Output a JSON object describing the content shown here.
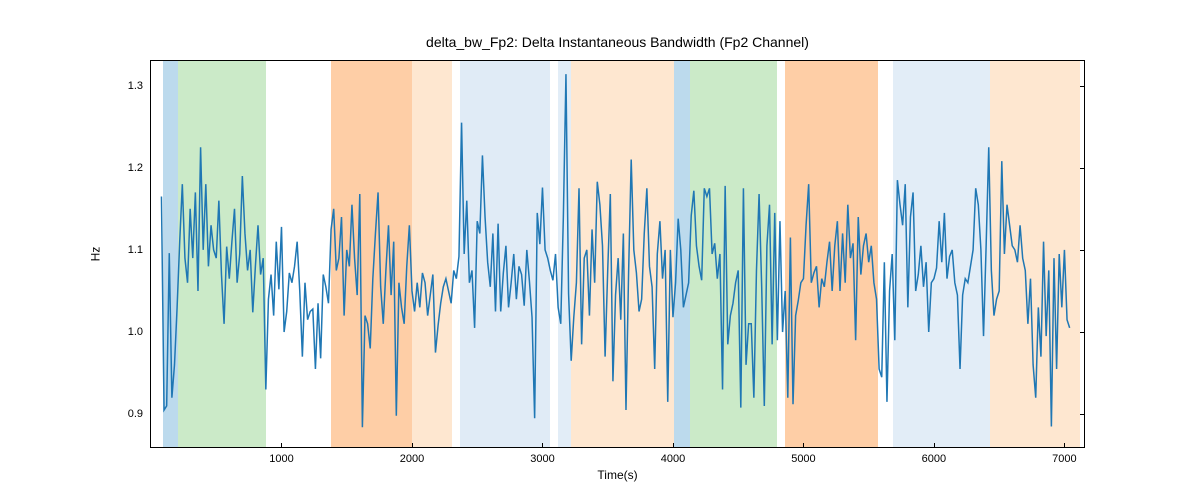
{
  "chart_data": {
    "type": "line",
    "title": "delta_bw_Fp2: Delta Instantaneous Bandwidth (Fp2 Channel)",
    "xlabel": "Time(s)",
    "ylabel": "Hz",
    "xlim": [
      0,
      7150
    ],
    "ylim": [
      0.86,
      1.33
    ],
    "xticks": [
      1000,
      2000,
      3000,
      4000,
      5000,
      6000,
      7000
    ],
    "yticks": [
      0.9,
      1.0,
      1.1,
      1.2,
      1.3
    ],
    "bands": [
      {
        "x0": 90,
        "x1": 210,
        "color": "#6baed6",
        "alpha": 0.45
      },
      {
        "x0": 210,
        "x1": 880,
        "color": "#a1d99b",
        "alpha": 0.55
      },
      {
        "x0": 1380,
        "x1": 2000,
        "color": "#fdae6b",
        "alpha": 0.6
      },
      {
        "x0": 2000,
        "x1": 2310,
        "color": "#fdd0a2",
        "alpha": 0.5
      },
      {
        "x0": 2370,
        "x1": 3060,
        "color": "#c6dbef",
        "alpha": 0.55
      },
      {
        "x0": 3120,
        "x1": 3220,
        "color": "#c6dbef",
        "alpha": 0.5
      },
      {
        "x0": 3220,
        "x1": 4010,
        "color": "#fdd0a2",
        "alpha": 0.5
      },
      {
        "x0": 4010,
        "x1": 4130,
        "color": "#6baed6",
        "alpha": 0.45
      },
      {
        "x0": 4130,
        "x1": 4800,
        "color": "#a1d99b",
        "alpha": 0.55
      },
      {
        "x0": 4860,
        "x1": 5570,
        "color": "#fdae6b",
        "alpha": 0.6
      },
      {
        "x0": 5690,
        "x1": 6430,
        "color": "#c6dbef",
        "alpha": 0.5
      },
      {
        "x0": 6430,
        "x1": 7120,
        "color": "#fdd0a2",
        "alpha": 0.5
      }
    ],
    "series": [
      {
        "name": "delta_bw_Fp2",
        "color": "#1f77b4",
        "x_step": 20,
        "x_start": 80,
        "values": [
          1.165,
          0.905,
          0.91,
          1.096,
          0.92,
          0.96,
          1.03,
          1.11,
          1.18,
          1.09,
          1.06,
          1.15,
          1.09,
          1.17,
          1.05,
          1.225,
          1.1,
          1.18,
          1.08,
          1.13,
          1.1,
          1.09,
          1.16,
          1.07,
          1.01,
          1.104,
          1.065,
          1.11,
          1.15,
          1.06,
          1.095,
          1.19,
          1.12,
          1.075,
          1.1,
          1.024,
          1.08,
          1.13,
          1.07,
          1.09,
          0.93,
          1.04,
          1.07,
          1.02,
          1.11,
          1.052,
          1.128,
          1.0,
          1.025,
          1.072,
          1.06,
          1.08,
          1.11,
          1.05,
          0.97,
          1.06,
          1.015,
          1.025,
          1.028,
          0.955,
          1.035,
          0.968,
          1.07,
          1.055,
          1.035,
          1.125,
          1.15,
          1.075,
          1.09,
          1.14,
          1.02,
          1.1,
          1.08,
          1.155,
          1.09,
          1.045,
          1.168,
          0.884,
          1.02,
          1.01,
          0.98,
          1.065,
          1.12,
          1.17,
          1.055,
          1.01,
          1.075,
          1.13,
          1.045,
          1.11,
          0.898,
          1.06,
          1.03,
          1.01,
          1.08,
          1.13,
          1.05,
          1.025,
          1.06,
          1.03,
          1.072,
          1.06,
          1.02,
          1.045,
          1.07,
          0.975,
          1.008,
          1.035,
          1.055,
          1.065,
          1.05,
          1.035,
          1.075,
          1.065,
          1.092,
          1.255,
          1.095,
          1.16,
          1.06,
          1.075,
          1.005,
          1.135,
          1.12,
          1.215,
          1.14,
          1.085,
          1.055,
          1.12,
          1.025,
          1.132,
          1.025,
          1.072,
          1.105,
          1.03,
          1.06,
          1.095,
          1.04,
          1.08,
          1.07,
          1.032,
          1.1,
          1.062,
          1.018,
          0.895,
          1.145,
          1.107,
          1.176,
          1.1,
          1.09,
          1.075,
          1.063,
          1.095,
          1.03,
          1.01,
          1.14,
          1.314,
          1.047,
          0.965,
          1.018,
          1.06,
          1.175,
          0.985,
          1.09,
          1.1,
          1.02,
          1.125,
          1.06,
          1.183,
          1.155,
          1.105,
          0.97,
          1.075,
          1.168,
          0.94,
          1.045,
          1.09,
          1.015,
          1.12,
          0.905,
          1.072,
          1.21,
          1.1,
          1.072,
          1.025,
          1.04,
          1.12,
          1.175,
          1.08,
          1.055,
          0.955,
          1.095,
          1.135,
          1.065,
          1.1,
          0.915,
          1.1,
          1.018,
          1.06,
          1.138,
          1.1,
          1.03,
          1.045,
          1.06,
          1.142,
          1.172,
          1.105,
          1.08,
          1.063,
          1.175,
          1.165,
          1.175,
          1.095,
          1.108,
          1.065,
          1.095,
          0.93,
          1.178,
          0.985,
          1.02,
          1.035,
          1.06,
          1.075,
          0.908,
          1.175,
          0.96,
          1.01,
          1.01,
          0.92,
          1.075,
          1.168,
          1.055,
          0.91,
          1.105,
          1.155,
          0.985,
          1.145,
          0.99,
          1.135,
          1.0,
          1.05,
          0.92,
          1.115,
          0.912,
          1.02,
          1.038,
          1.06,
          1.065,
          1.13,
          1.18,
          1.06,
          1.072,
          1.08,
          1.03,
          1.065,
          1.055,
          1.085,
          1.11,
          1.05,
          1.105,
          1.135,
          1.05,
          1.12,
          1.06,
          1.155,
          1.09,
          1.108,
          0.99,
          1.14,
          1.07,
          1.105,
          1.12,
          1.085,
          1.105,
          1.06,
          1.04,
          0.955,
          0.945,
          1.085,
          0.915,
          1.05,
          1.095,
          0.99,
          1.185,
          1.155,
          1.13,
          1.18,
          1.03,
          1.14,
          1.17,
          1.05,
          1.07,
          1.105,
          1.055,
          1.085,
          1.0,
          1.06,
          1.065,
          1.078,
          1.135,
          1.085,
          1.145,
          1.065,
          1.092,
          1.1,
          1.06,
          1.045,
          0.955,
          1.045,
          1.065,
          1.06,
          1.08,
          1.1,
          1.175,
          1.155,
          1.1,
          0.995,
          1.105,
          1.225,
          1.075,
          1.02,
          1.04,
          1.05,
          1.208,
          1.095,
          1.155,
          1.13,
          1.105,
          1.1,
          1.085,
          1.13,
          1.09,
          1.075,
          1.01,
          1.065,
          0.96,
          0.92,
          1.03,
          0.97,
          1.11,
          0.995,
          1.075,
          0.885,
          1.09,
          0.955,
          1.095,
          1.03,
          1.1,
          1.015,
          1.005
        ]
      }
    ]
  }
}
